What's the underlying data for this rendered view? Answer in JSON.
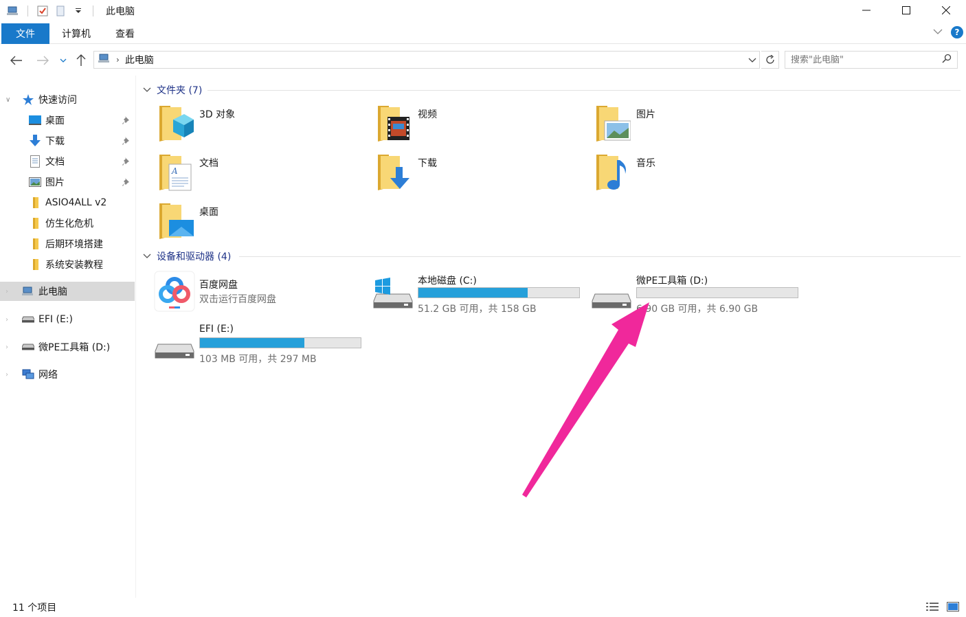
{
  "window": {
    "title": "此电脑",
    "controls": [
      "minimize",
      "maximize",
      "close"
    ]
  },
  "quick_access_toolbar": {
    "icons": [
      "computer-icon",
      "properties-icon",
      "new-folder-icon",
      "customize-dropdown-icon"
    ]
  },
  "ribbon": {
    "tabs": [
      {
        "label": "文件",
        "active": true
      },
      {
        "label": "计算机"
      },
      {
        "label": "查看"
      }
    ],
    "help_label": "?"
  },
  "address_bar": {
    "path": [
      "此电脑"
    ],
    "search_placeholder": "搜索\"此电脑\""
  },
  "sidebar": {
    "quick_access_label": "快速访问",
    "pinned": [
      {
        "label": "桌面",
        "icon": "desktop-icon"
      },
      {
        "label": "下载",
        "icon": "download-icon"
      },
      {
        "label": "文档",
        "icon": "document-icon"
      },
      {
        "label": "图片",
        "icon": "pictures-icon"
      }
    ],
    "folders": [
      {
        "label": "ASIO4ALL v2"
      },
      {
        "label": "仿生化危机"
      },
      {
        "label": "后期环境搭建"
      },
      {
        "label": "系统安装教程"
      }
    ],
    "this_pc_label": "此电脑",
    "efi_label": "EFI (E:)",
    "wepe_label": "微PE工具箱 (D:)",
    "network_label": "网络"
  },
  "main": {
    "folders_header": "文件夹 (7)",
    "folders": [
      {
        "label": "3D 对象",
        "icon": "3d-objects-icon"
      },
      {
        "label": "视频",
        "icon": "videos-icon"
      },
      {
        "label": "图片",
        "icon": "pictures-icon"
      },
      {
        "label": "文档",
        "icon": "documents-icon"
      },
      {
        "label": "下载",
        "icon": "downloads-icon"
      },
      {
        "label": "音乐",
        "icon": "music-icon"
      },
      {
        "label": "桌面",
        "icon": "desktop-icon"
      }
    ],
    "devices_header": "设备和驱动器 (4)",
    "devices": [
      {
        "label": "百度网盘",
        "sub": "双击运行百度网盘",
        "icon": "baidu-netdisk-icon"
      },
      {
        "label": "本地磁盘 (C:)",
        "free": "51.2 GB 可用，共 158 GB",
        "used_fraction": 0.68,
        "icon": "windows-drive-icon"
      },
      {
        "label": "微PE工具箱 (D:)",
        "free": "6.90 GB 可用，共 6.90 GB",
        "used_fraction": 0.0,
        "icon": "drive-icon"
      },
      {
        "label": "EFI (E:)",
        "free": "103 MB 可用，共 297 MB",
        "used_fraction": 0.65,
        "icon": "drive-icon"
      }
    ]
  },
  "status_bar": {
    "item_count": "11 个项目"
  },
  "colors": {
    "accent": "#1979ca",
    "bar_fill": "#26a0da",
    "header_text": "#1e3287",
    "annotation_arrow": "#f0289b"
  }
}
